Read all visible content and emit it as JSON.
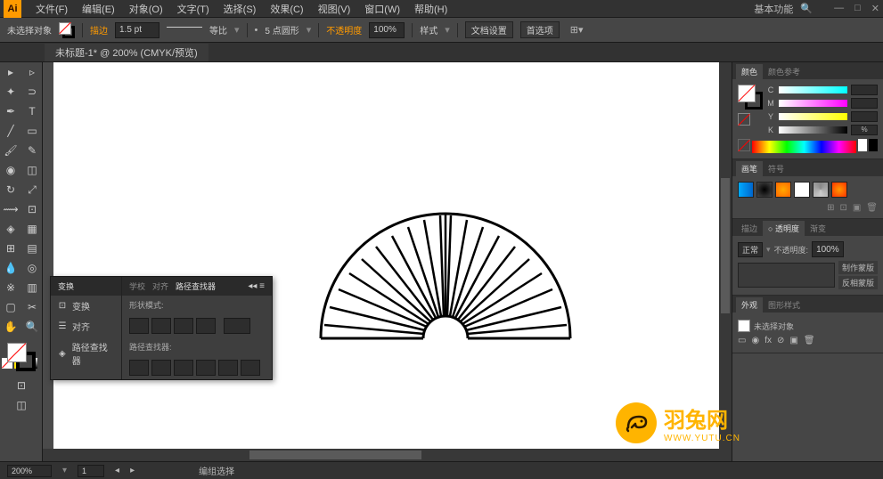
{
  "app": {
    "icon": "Ai",
    "workspace": "基本功能"
  },
  "menu": [
    "文件(F)",
    "编辑(E)",
    "对象(O)",
    "文字(T)",
    "选择(S)",
    "效果(C)",
    "视图(V)",
    "窗口(W)",
    "帮助(H)"
  ],
  "controlbar": {
    "selection": "未选择对象",
    "stroke_label": "描边",
    "stroke_weight": "1.5 pt",
    "stroke_style": "等比",
    "stroke_profile": "5 点圆形",
    "opacity_label": "不透明度",
    "opacity_val": "100%",
    "style_label": "样式",
    "doc_setup": "文档设置",
    "prefs": "首选项"
  },
  "doctab": "未标题-1* @ 200% (CMYK/预览)",
  "pathfinder": {
    "col_tabs": [
      "变换",
      "对齐",
      "路径查找器"
    ],
    "col_items": [
      "变换",
      "对齐",
      "路径查找器"
    ],
    "right_tabs": [
      "学校",
      "对齐",
      "路径查找器"
    ],
    "shape_mode_label": "形状模式:",
    "pathfinder_label": "路径查找器:"
  },
  "color_panel": {
    "tab1": "颜色",
    "tab2": "颜色参考",
    "channels": [
      "C",
      "M",
      "Y",
      "K"
    ],
    "values": [
      "",
      "",
      "",
      "%"
    ]
  },
  "swatches_panel": {
    "tab1": "画笔",
    "tab2": "符号"
  },
  "opacity_panel": {
    "tab1": "描边",
    "tab2": "○ 透明度",
    "tab3": "渐变",
    "blend": "正常",
    "opacity_label": "不透明度:",
    "opacity_val": "100%",
    "btn1": "制作蒙版",
    "btn2": "反相蒙版"
  },
  "appearance_panel": {
    "tab1": "外观",
    "tab2": "图形样式",
    "no_select": "未选择对象"
  },
  "status": {
    "zoom": "200%",
    "artboard": "1",
    "tool": "编组选择"
  },
  "watermark": {
    "main": "羽兔网",
    "sub": "WWW.YUTU.CN"
  }
}
